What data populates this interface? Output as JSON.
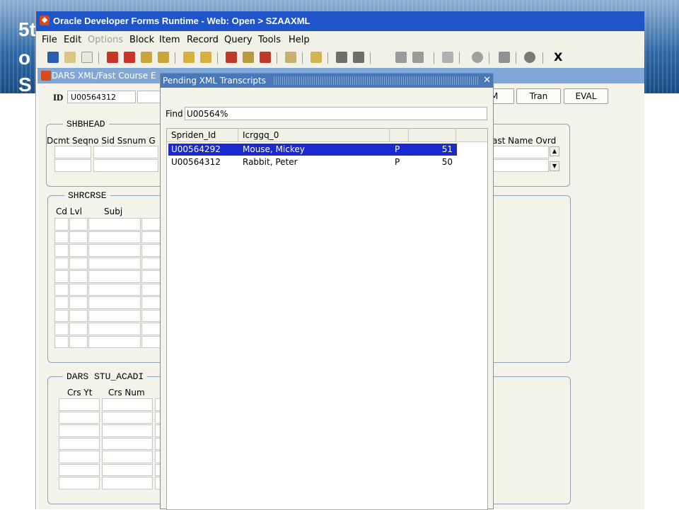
{
  "slide": {
    "title_lines": [
      "5t",
      "o",
      "S"
    ]
  },
  "window": {
    "title": "Oracle Developer Forms Runtime - Web:  Open > SZAAXML",
    "menu": [
      {
        "label": "File",
        "disabled": false
      },
      {
        "label": "Edit",
        "disabled": false
      },
      {
        "label": "Options",
        "disabled": true
      },
      {
        "label": "Block",
        "disabled": false
      },
      {
        "label": "Item",
        "disabled": false
      },
      {
        "label": "Record",
        "disabled": false
      },
      {
        "label": "Query",
        "disabled": false
      },
      {
        "label": "Tools",
        "disabled": false
      },
      {
        "label": "Help",
        "disabled": false
      }
    ],
    "toolbar_close": "X"
  },
  "form": {
    "title": "DARS XML/Fast Course E",
    "id_label": "ID",
    "id_value": "U00564312",
    "buttons": {
      "m": "M",
      "tran": "Tran",
      "eval": "EVAL"
    },
    "shbhead": {
      "title": "SHBHEAD",
      "col_labels": "Dcmt Seqno Sid Ssnum  G",
      "right_label": "ast Name Ovrd"
    },
    "shrcrse": {
      "title": "SHRCRSE",
      "col_cd_lvl": "Cd Lvl",
      "col_subj": "Subj",
      "col_tail": "("
    },
    "dars": {
      "title": "DARS  STU_ACADI",
      "col_crs_yt": "Crs Yt",
      "col_crs_num": "Crs Num"
    }
  },
  "dialog": {
    "title": "Pending XML Transcripts",
    "close": "✕",
    "find_label": "Find",
    "find_value": "U00564%",
    "columns": [
      "Spriden_Id",
      "Icrggq_0",
      "",
      ""
    ],
    "rows": [
      {
        "id": "U00564292",
        "name": "Mouse, Mickey",
        "flag": "P",
        "num": "51",
        "selected": true
      },
      {
        "id": "U00564312",
        "name": "Rabbit, Peter",
        "flag": "P",
        "num": "50",
        "selected": false
      }
    ]
  }
}
